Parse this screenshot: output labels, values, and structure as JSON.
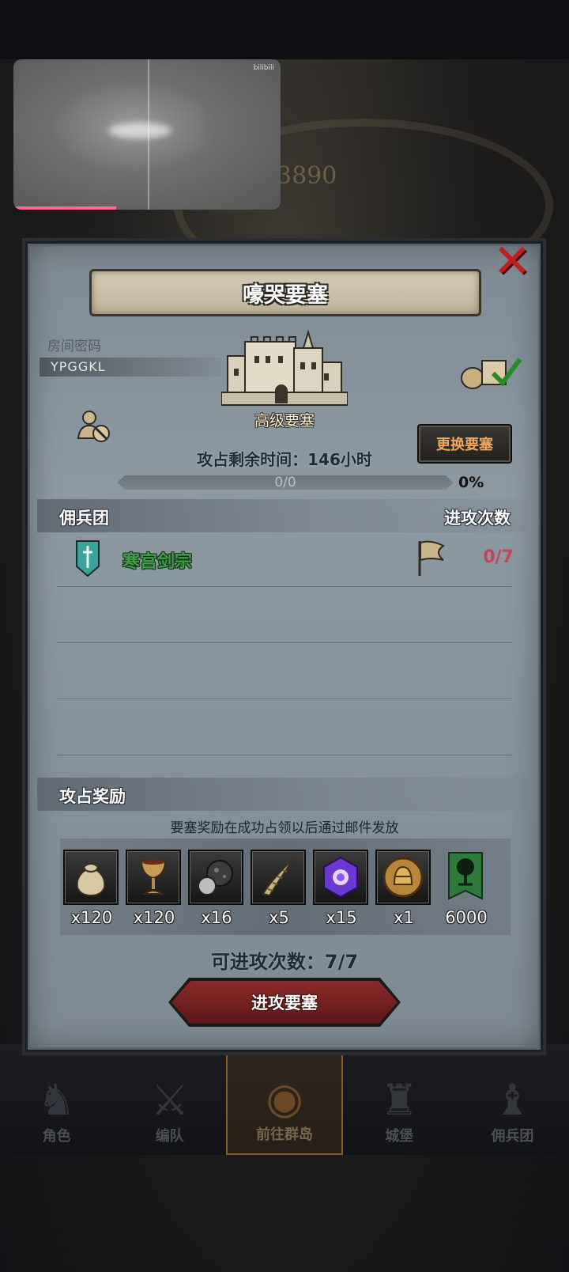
{
  "background": {
    "score_text": "3890"
  },
  "video_overlay": {
    "watermark": "bilibili"
  },
  "dialog": {
    "title": "嚎哭要塞",
    "room_password_label": "房间密码",
    "room_password_value": "YPGGKL",
    "fortress_type": "高级要塞",
    "change_button": "更换要塞",
    "time_remaining": "攻占剩余时间：146小时",
    "progress_text": "0/0",
    "progress_percent": "0%",
    "progress_fraction": 0,
    "mercenary_header": "佣兵团",
    "attacks_header": "进攻次数",
    "mercenaries": [
      {
        "name": "寒宫剑宗",
        "count": "0/7",
        "shield_color": "#3aa39a",
        "flag_color": "#c9b58a"
      }
    ],
    "reward_header": "攻占奖励",
    "reward_note": "要塞奖励在成功占领以后通过邮件发放",
    "rewards": [
      {
        "icon": "coin-bag-icon",
        "qty": "x120"
      },
      {
        "icon": "goblet-icon",
        "qty": "x120"
      },
      {
        "icon": "ore-icon",
        "qty": "x16"
      },
      {
        "icon": "horn-icon",
        "qty": "x5"
      },
      {
        "icon": "purple-gem-icon",
        "qty": "x15"
      },
      {
        "icon": "helmet-medal-icon",
        "qty": "x1"
      },
      {
        "icon": "tree-banner-icon",
        "qty": "6000"
      }
    ],
    "attack_count": "可进攻次数：7/7",
    "attack_button": "进攻要塞"
  },
  "bottom_nav": [
    {
      "label": "角色",
      "icon": "knight-icon"
    },
    {
      "label": "编队",
      "icon": "formation-icon"
    },
    {
      "label": "前往群岛",
      "icon": "globe-icon",
      "active": true
    },
    {
      "label": "城堡",
      "icon": "castle-icon"
    },
    {
      "label": "佣兵团",
      "icon": "mercenary-icon"
    }
  ]
}
